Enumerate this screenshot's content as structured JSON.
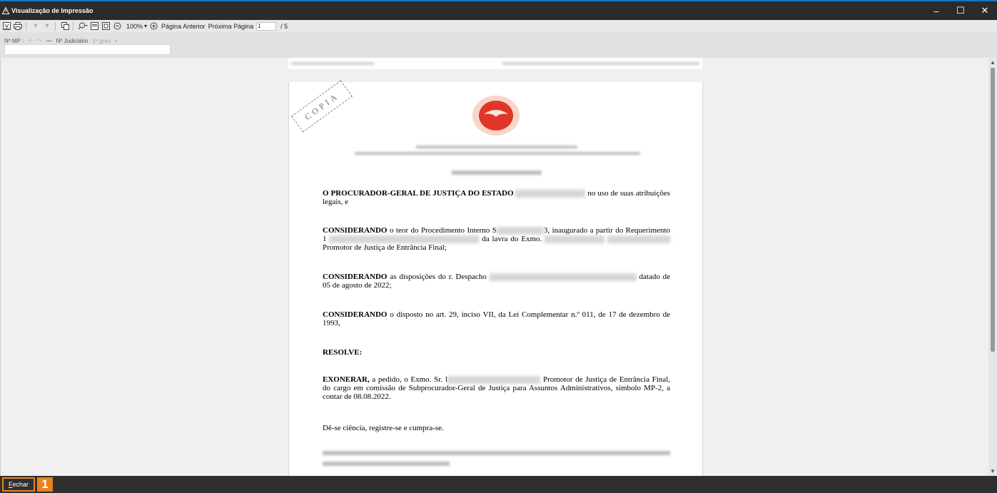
{
  "window": {
    "title": "Visualização de Impressão",
    "minimize": "–",
    "maximize": "☐",
    "close": "✕"
  },
  "toolbar": {
    "zoom": "100%",
    "prev_page": "Página Anterior",
    "next_page": "Próxima Página",
    "page_value": "1",
    "page_total": "/ 5"
  },
  "infobar": {
    "mp_label": "Nº MP :",
    "more": "···",
    "judicial_label": "Nº Judiciário",
    "grade": "1º grau"
  },
  "document": {
    "stamp": "COPIA",
    "p1_bold": "O PROCURADOR-GERAL DE JUSTIÇA DO ESTADO",
    "p1_rest": "no uso de suas atribuições legais, e",
    "p2_bold": "CONSIDERANDO",
    "p2_a": "o teor do Procedimento Interno S",
    "p2_b": "3, inaugurado a partir do Requerimento 1",
    "p2_c": "da lavra do Exmo.",
    "p2_d": "Promotor de Justiça de Entrância Final;",
    "p3_bold": "CONSIDERANDO",
    "p3_a": "as disposições do r. Despacho",
    "p3_b": "datado de 05 de agosto de 2022;",
    "p4_bold": "CONSIDERANDO",
    "p4_a": "o disposto no art. 29, inciso VII, da Lei Complementar n.º 011, de 17 de dezembro de 1993,",
    "resolve": "RESOLVE:",
    "p5_bold": "EXONERAR,",
    "p5_a": "a pedido, o Exmo. Sr. I",
    "p5_b": "Promotor de Justiça de Entrância Final, do cargo em comissão de Subprocurador-Geral de Justiça para Assuntos Administrativos, símbolo MP-2,  a contar de 08.08.2022.",
    "p6": "Dê-se ciência, registre-se e cumpra-se."
  },
  "status": {
    "close_key": "F",
    "close_rest": "echar",
    "badge": "1"
  },
  "colors": {
    "accent": "#e8821e",
    "titlebar": "#2b2b2b",
    "logo_red": "#e0362a"
  }
}
